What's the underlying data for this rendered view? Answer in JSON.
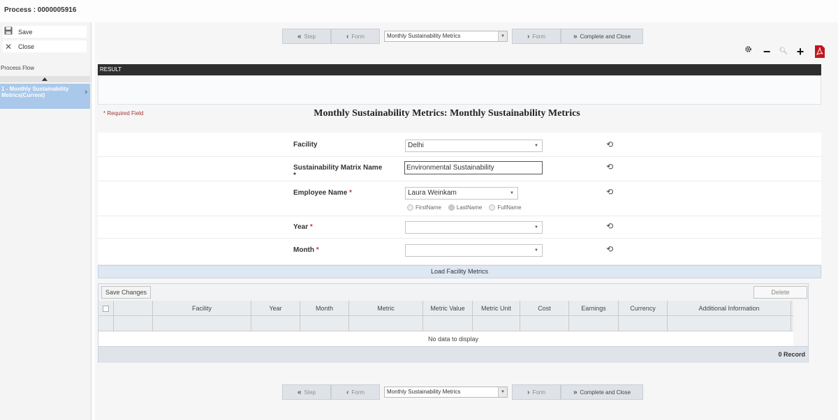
{
  "window": {
    "title": "Process : 0000005916"
  },
  "left_toolbar": {
    "save_label": "Save",
    "close_label": "Close"
  },
  "process_flow": {
    "label": "Process Flow",
    "current_step": "1 - Monthly Sustainability Metrics(Current)"
  },
  "nav": {
    "step_back_label": "Step",
    "form_back_label": "Form",
    "form_select_value": "Monthly Sustainability Metrics",
    "form_forward_label": "Form",
    "complete_label": "Complete and Close"
  },
  "result": {
    "header": "RESULT"
  },
  "form": {
    "required_note": "* Required Field",
    "title": "Monthly Sustainability Metrics: Monthly Sustainability Metrics",
    "fields": {
      "facility": {
        "label": "Facility",
        "value": "Delhi"
      },
      "matrix_name": {
        "label": "Sustainability Matrix Name",
        "required_mark": "*",
        "value": "Environmental Sustainability"
      },
      "employee": {
        "label": "Employee Name",
        "required_mark": "*",
        "value": "Laura Weinkam"
      },
      "year": {
        "label": "Year",
        "required_mark": "*",
        "value": ""
      },
      "month": {
        "label": "Month",
        "required_mark": "*",
        "value": ""
      }
    },
    "name_format_options": [
      "FirstName",
      "LastName",
      "FullName"
    ],
    "name_format_selected": "LastName"
  },
  "load_button": {
    "label": "Load Facility Metrics"
  },
  "grid": {
    "save_label": "Save Changes",
    "delete_label": "Delete",
    "columns": [
      "Facility",
      "Year",
      "Month",
      "Metric",
      "Metric Value",
      "Metric Unit",
      "Cost",
      "Earnings",
      "Currency",
      "Additional Information"
    ],
    "empty_text": "No data to display",
    "record_count": "0 Record"
  },
  "colors": {
    "accent": "#a9c8ea",
    "header_dark": "#2e2e2e",
    "load_bar": "#dde8f3"
  },
  "icons": [
    "save-icon",
    "close-icon",
    "settings-icon",
    "zoom-out-icon",
    "zoom-reset-icon",
    "zoom-in-icon",
    "pdf-icon",
    "history-icon"
  ]
}
